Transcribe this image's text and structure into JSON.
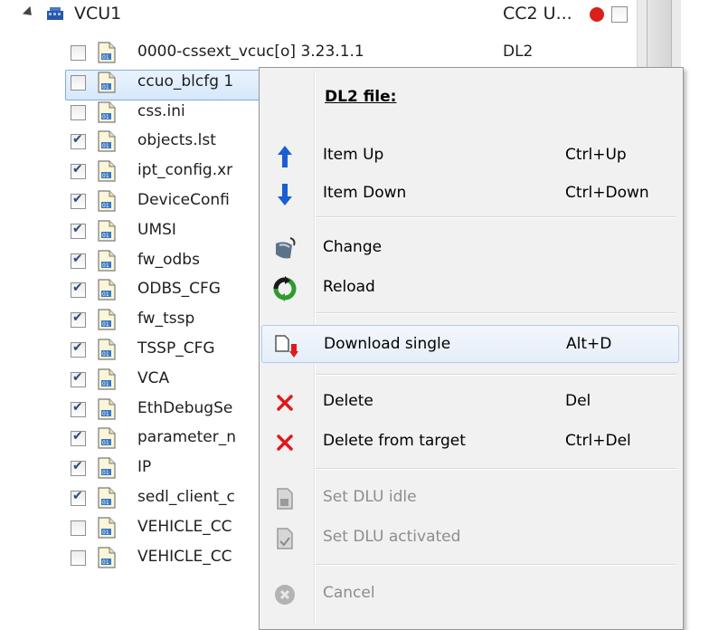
{
  "root": {
    "label": "VCU1",
    "status": "CC2 U..."
  },
  "rows": [
    {
      "label": "0000-cssext_vcuc[o] 3.23.1.1",
      "status": "DL2",
      "checked": false
    },
    {
      "label": "ccuo_blcfg 1",
      "status": "",
      "checked": false
    },
    {
      "label": "css.ini",
      "status": "",
      "checked": false
    },
    {
      "label": "objects.lst",
      "status": "",
      "checked": true
    },
    {
      "label": "ipt_config.xr",
      "status": "",
      "checked": true
    },
    {
      "label": "DeviceConfi",
      "status": "",
      "checked": true
    },
    {
      "label": "UMSI",
      "status": "",
      "checked": true
    },
    {
      "label": "fw_odbs",
      "status": "",
      "checked": true
    },
    {
      "label": "ODBS_CFG",
      "status": "",
      "checked": true
    },
    {
      "label": "fw_tssp",
      "status": "",
      "checked": true
    },
    {
      "label": "TSSP_CFG",
      "status": "",
      "checked": true
    },
    {
      "label": "VCA",
      "status": "",
      "checked": true
    },
    {
      "label": "EthDebugSe",
      "status": "",
      "checked": true
    },
    {
      "label": "parameter_n",
      "status": "",
      "checked": true
    },
    {
      "label": "IP",
      "status": "",
      "checked": true
    },
    {
      "label": "sedl_client_c",
      "status": "",
      "checked": true
    },
    {
      "label": "VEHICLE_CC",
      "status": "",
      "checked": false
    },
    {
      "label": "VEHICLE_CC",
      "status": "",
      "checked": false
    }
  ],
  "menu": {
    "title": "DL2 file:",
    "items": [
      {
        "label": "Item Up",
        "shortcut": "Ctrl+Up",
        "icon": "arrow-up-icon"
      },
      {
        "label": "Item Down",
        "shortcut": "Ctrl+Down",
        "icon": "arrow-down-icon"
      },
      {
        "label": "Change",
        "shortcut": "",
        "icon": "change-icon"
      },
      {
        "label": "Reload",
        "shortcut": "",
        "icon": "reload-icon"
      },
      {
        "label": "Download single",
        "shortcut": "Alt+D",
        "icon": "download-icon"
      },
      {
        "label": "Delete",
        "shortcut": "Del",
        "icon": "delete-icon"
      },
      {
        "label": "Delete from target",
        "shortcut": "Ctrl+Del",
        "icon": "delete-icon"
      },
      {
        "label": "Set DLU idle",
        "shortcut": "",
        "icon": "file-gray-icon"
      },
      {
        "label": "Set DLU activated",
        "shortcut": "",
        "icon": "file-gray-icon"
      },
      {
        "label": "Cancel",
        "shortcut": "",
        "icon": "cancel-icon"
      }
    ]
  },
  "colors": {
    "accent_blue": "#1a5fd1",
    "delete_red": "#e0181c",
    "status_red": "#d9201c"
  }
}
